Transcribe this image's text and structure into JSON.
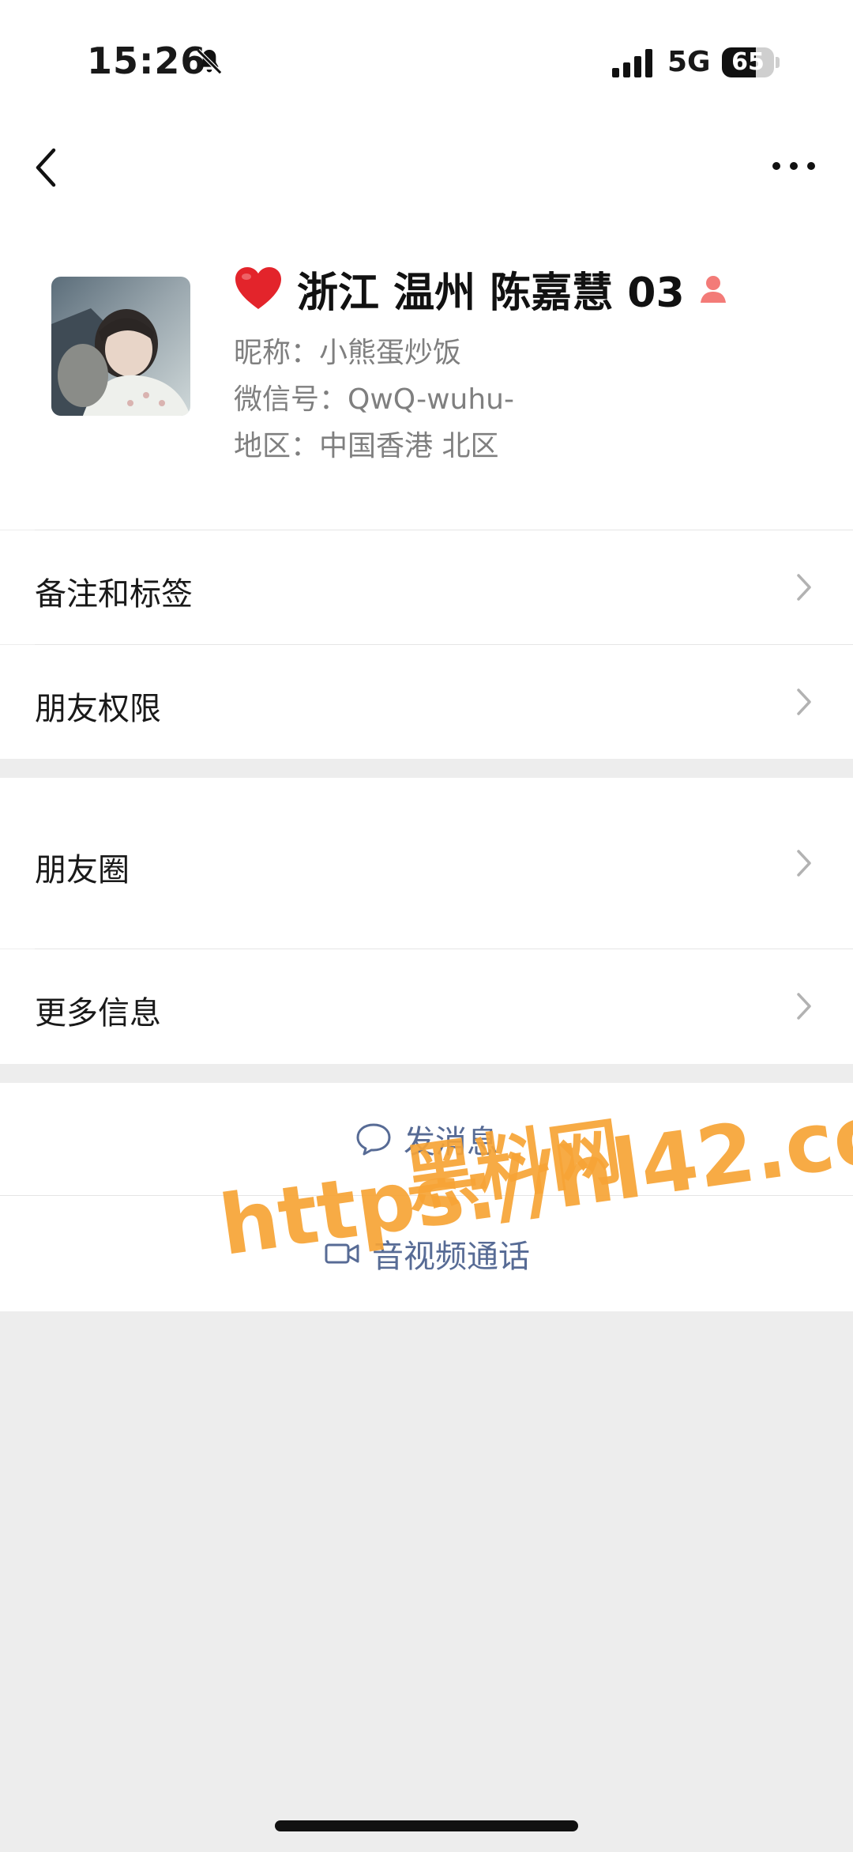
{
  "status_bar": {
    "time": "15:26",
    "network": "5G",
    "battery": "65",
    "battery_level": 0.65
  },
  "nav": {
    "back_icon": "chevron-left-icon",
    "more_icon": "ellipsis-icon"
  },
  "profile": {
    "name": "浙江 温州 陈嘉慧 03",
    "nickname": "昵称：小熊蛋炒饭",
    "wechat_id": "微信号：QwQ-wuhu-",
    "region": "地区：中国香港 北区",
    "gender_icon": "female-icon",
    "heart_icon": "red-heart-icon"
  },
  "cells": {
    "remarks": "备注和标签",
    "permissions": "朋友权限",
    "moments": "朋友圈",
    "more_info": "更多信息"
  },
  "actions": {
    "send_message": "发消息",
    "call": "音视频通话"
  },
  "watermark": {
    "line1": "黑料网",
    "line2": "https://hl42.co"
  },
  "colors": {
    "link": "#576b95",
    "background": "#ededed",
    "watermark": "#f7a436"
  }
}
